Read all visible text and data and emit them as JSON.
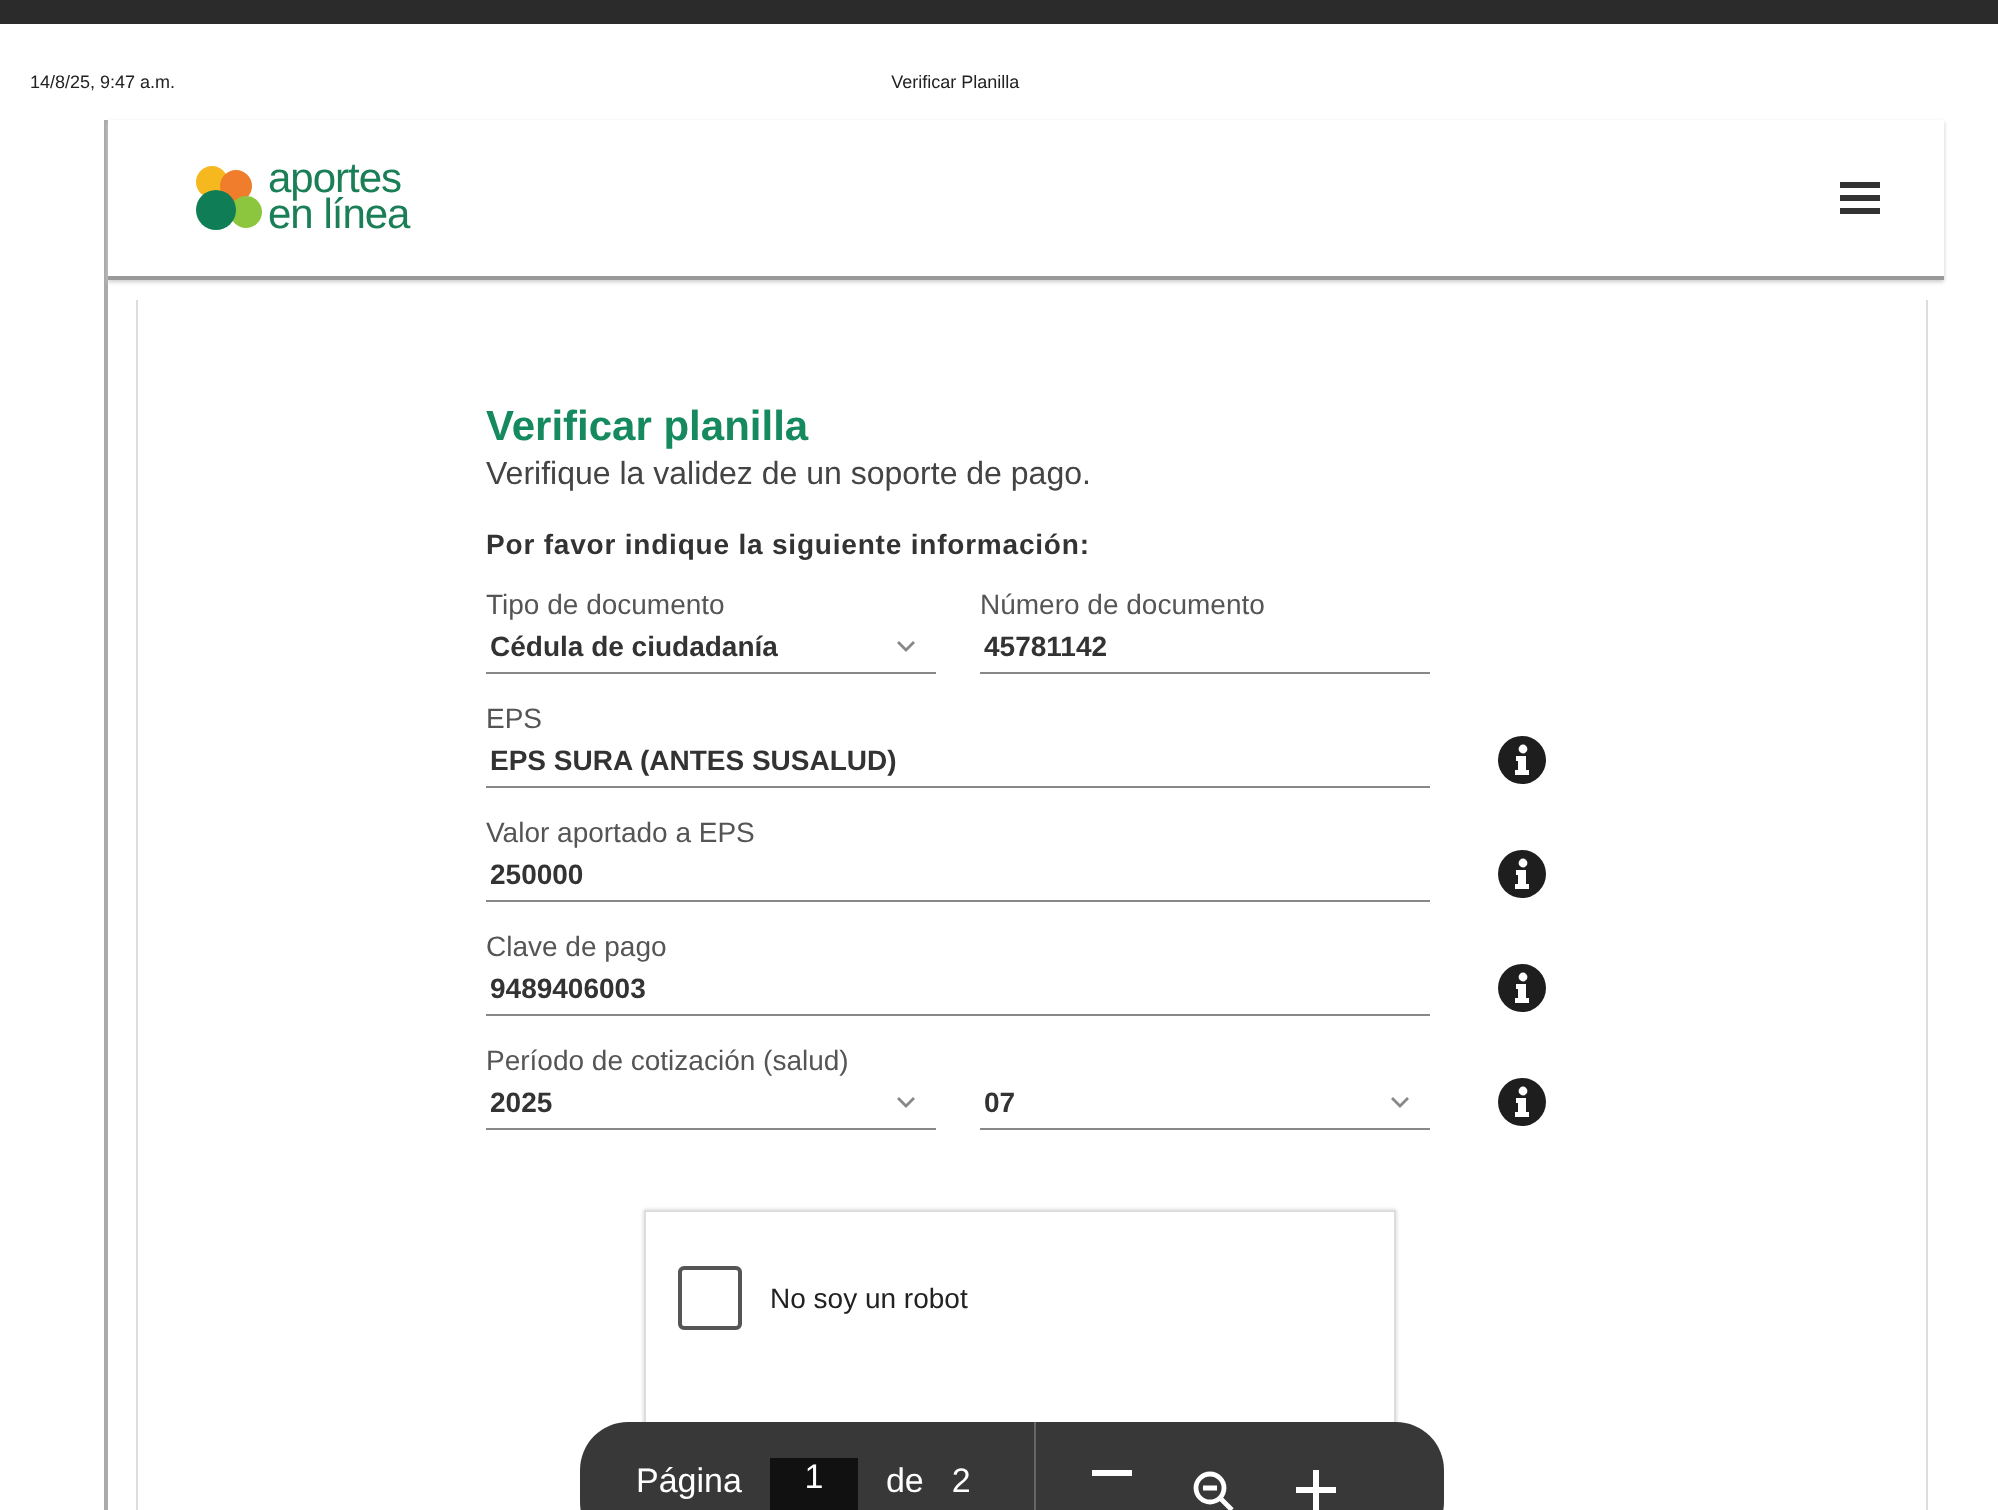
{
  "print_header": {
    "date": "14/8/25, 9:47 a.m.",
    "title": "Verificar Planilla"
  },
  "site": {
    "logo_lines": [
      "aportes",
      "en línea"
    ]
  },
  "form": {
    "title": "Verificar planilla",
    "subtitle": "Verifique la validez de un soporte de pago.",
    "instruction": "Por favor indique la siguiente información:",
    "rows": [
      {
        "fields": [
          {
            "label": "Tipo de documento",
            "value": "Cédula de ciudadanía",
            "kind": "select"
          },
          {
            "label": "Número de documento",
            "value": "45781142",
            "kind": "text"
          }
        ],
        "info": false
      },
      {
        "fields": [
          {
            "label": "EPS",
            "value": "EPS SURA (ANTES SUSALUD)",
            "kind": "text"
          }
        ],
        "info": true
      },
      {
        "fields": [
          {
            "label": "Valor aportado a EPS",
            "value": "250000",
            "kind": "text"
          }
        ],
        "info": true
      },
      {
        "fields": [
          {
            "label": "Clave de pago",
            "value": "9489406003",
            "kind": "text"
          }
        ],
        "info": true
      },
      {
        "label": "Período de cotización (salud)",
        "fields": [
          {
            "value": "2025",
            "kind": "select"
          },
          {
            "value": "07",
            "kind": "select"
          }
        ],
        "info": true
      }
    ]
  },
  "captcha": {
    "label": "No soy un robot",
    "checked": false
  },
  "toolbar": {
    "page_label": "Página",
    "page": "1",
    "of": "de",
    "total": "2"
  }
}
